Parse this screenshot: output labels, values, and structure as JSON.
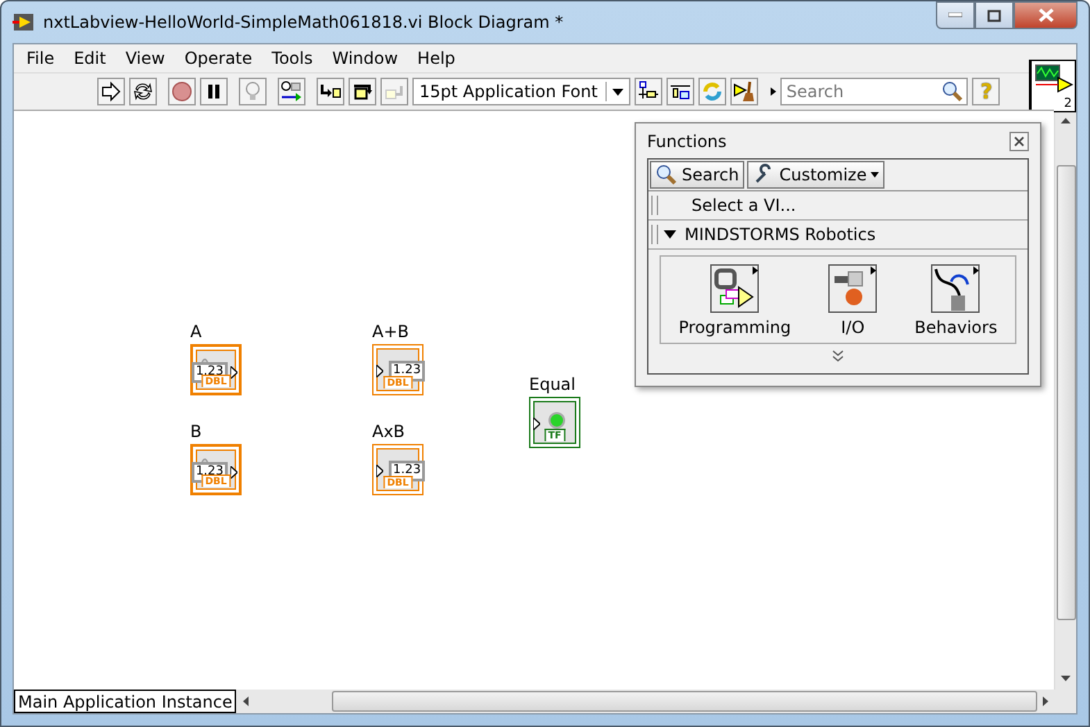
{
  "window": {
    "title": "nxtLabview-HelloWorld-SimpleMath061818.vi Block Diagram *"
  },
  "menu": [
    "File",
    "Edit",
    "View",
    "Operate",
    "Tools",
    "Window",
    "Help"
  ],
  "toolbar": {
    "font": "15pt Application Font",
    "search": {
      "placeholder": "Search"
    },
    "help": "?",
    "connector_count": "2"
  },
  "nodes": [
    {
      "label": "A",
      "kind": "control",
      "value": "1.23",
      "type": "DBL"
    },
    {
      "label": "B",
      "kind": "control",
      "value": "1.23",
      "type": "DBL"
    },
    {
      "label": "A+B",
      "kind": "indicator",
      "value": "1.23",
      "type": "DBL"
    },
    {
      "label": "AxB",
      "kind": "indicator",
      "value": "1.23",
      "type": "DBL"
    },
    {
      "label": "Equal",
      "kind": "led",
      "type": "TF"
    }
  ],
  "functions_palette": {
    "title": "Functions",
    "buttons": [
      "Search",
      "Customize"
    ],
    "select_vi": "Select a VI...",
    "category": {
      "label": "MINDSTORMS Robotics",
      "expanded": true,
      "items": [
        "Programming",
        "I/O",
        "Behaviors"
      ]
    }
  },
  "status_bar": {
    "context": "Main Application Instance"
  }
}
